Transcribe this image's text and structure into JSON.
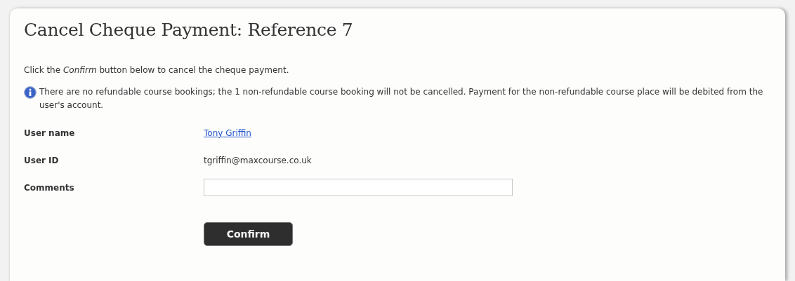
{
  "title": "Cancel Cheque Payment: Reference 7",
  "instruction": "Click the *Confirm* button below to cancel the cheque payment.",
  "info": "There are no refundable course bookings; the 1 non-refundable course booking will not be cancelled. Payment for the non-refundable course place will be debited from the user's account.",
  "fields": [
    {
      "label": "User name",
      "kind": "link",
      "value": "Tony Griffin"
    },
    {
      "label": "User ID",
      "kind": "text",
      "value": "tgriffin@maxcourse.co.uk"
    },
    {
      "label": "Comments",
      "kind": "input"
    }
  ],
  "buttons": [
    "Confirm"
  ]
}
